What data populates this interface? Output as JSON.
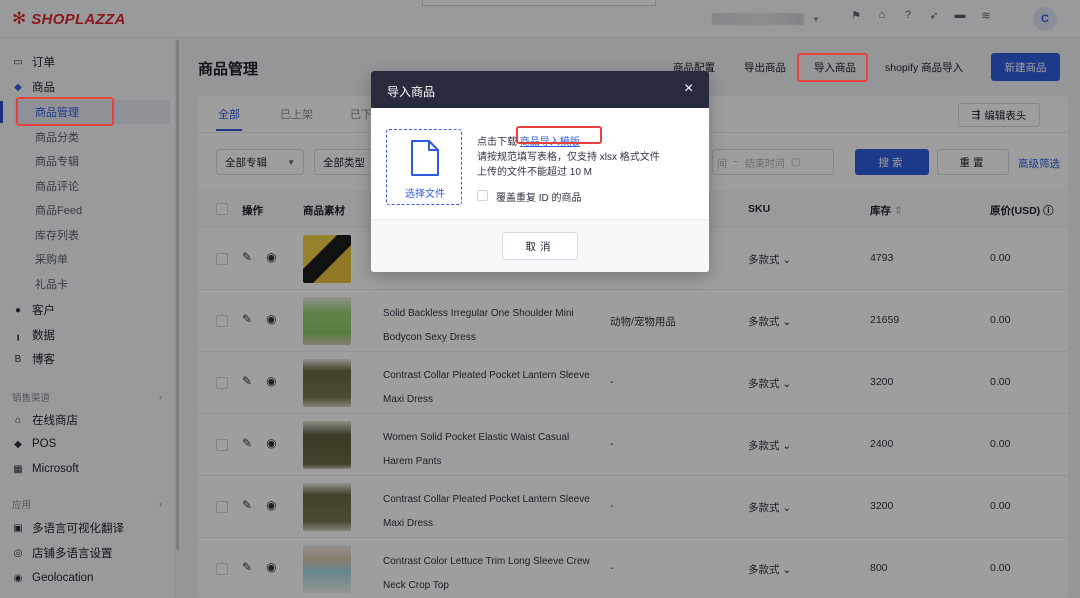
{
  "brand": {
    "logo_text": "SHOPLAZZA",
    "logo_color": "#e0282e"
  },
  "topbar": {
    "avatar_letter": "C"
  },
  "sidebar": {
    "orders": "订单",
    "products": "商品",
    "product_children": [
      "商品管理",
      "商品分类",
      "商品专辑",
      "商品评论",
      "商品Feed",
      "库存列表",
      "采购单",
      "礼品卡"
    ],
    "customers": "客户",
    "data": "数据",
    "blog": "博客",
    "sales_channels_group": "销售渠道",
    "online_store": "在线商店",
    "pos": "POS",
    "microsoft": "Microsoft",
    "apps_group": "应用",
    "app_translate": "多语言可视化翻译",
    "app_multilang": "店铺多语言设置",
    "app_geolocation": "Geolocation"
  },
  "header": {
    "title": "商品管理",
    "product_config": "商品配置",
    "export_products": "导出商品",
    "import_products": "导入商品",
    "shopify_import": "shopify 商品导入",
    "new_product": "新建商品"
  },
  "tabs": [
    "全部",
    "已上架",
    "已下"
  ],
  "edit_columns": "编辑表头",
  "filters": {
    "collection": "全部专辑",
    "type": "全部类型",
    "date_start_fragment": "间",
    "date_end": "结束时间",
    "search": "搜索",
    "reset": "重置",
    "advanced": "高级筛选"
  },
  "table": {
    "headers": {
      "ops": "操作",
      "media": "商品素材",
      "sku": "SKU",
      "stock": "库存",
      "price": "原价(USD)"
    },
    "rows": [
      {
        "name": "",
        "type": "",
        "sku": "多款式",
        "stock": "4793",
        "price": "0.00"
      },
      {
        "name": "Solid Backless Irregular One Shoulder Mini Bodycon Sexy Dress",
        "type": "动物/宠物用品",
        "sku": "多款式",
        "stock": "21659",
        "price": "0.00"
      },
      {
        "name": "Contrast Collar Pleated Pocket Lantern Sleeve Maxi Dress",
        "type": "-",
        "sku": "多款式",
        "stock": "3200",
        "price": "0.00"
      },
      {
        "name": "Women Solid Pocket Elastic Waist Casual Harem Pants",
        "type": "-",
        "sku": "多款式",
        "stock": "2400",
        "price": "0.00"
      },
      {
        "name": "Contrast Collar Pleated Pocket Lantern Sleeve Maxi Dress",
        "type": "-",
        "sku": "多款式",
        "stock": "3200",
        "price": "0.00"
      },
      {
        "name": "Contrast Color Lettuce Trim Long Sleeve Crew Neck Crop Top",
        "type": "-",
        "sku": "多款式",
        "stock": "800",
        "price": "0.00"
      }
    ]
  },
  "modal": {
    "title": "导入商品",
    "select_file": "选择文件",
    "line1_prefix": "点击下载",
    "template_link": "商品导入模版",
    "line2": "请按规范填写表格，仅支持 xlsx 格式文件",
    "line3": "上传的文件不能超过 10 M",
    "overwrite_label": "覆盖重复 ID 的商品",
    "cancel": "取消"
  },
  "colors": {
    "primary": "#2f5cdd",
    "highlight": "#e8403a",
    "modal_header": "#272b3c"
  }
}
